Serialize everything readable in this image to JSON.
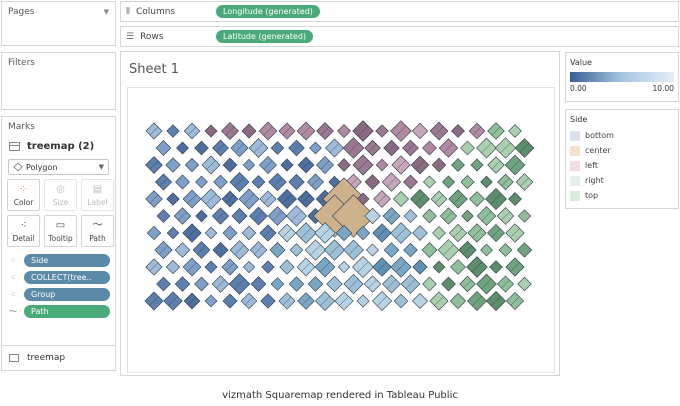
{
  "pages": {
    "title": "Pages"
  },
  "filters": {
    "title": "Filters"
  },
  "marks": {
    "title": "Marks",
    "layer": "treemap (2)",
    "mark_type": "Polygon",
    "buttons": [
      "Color",
      "Size",
      "Label",
      "Detail",
      "Tooltip",
      "Path"
    ],
    "pills": [
      {
        "label": "Side",
        "kind": "color"
      },
      {
        "label": "COLLECT(tree..",
        "kind": "detail"
      },
      {
        "label": "Group",
        "kind": "detail"
      },
      {
        "label": "Path",
        "kind": "path"
      }
    ]
  },
  "sheet_tab": {
    "label": "treemap"
  },
  "shelves": {
    "columns": {
      "label": "Columns",
      "pill": "Longitude (generated)"
    },
    "rows": {
      "label": "Rows",
      "pill": "Latitude (generated)"
    }
  },
  "sheet": {
    "title": "Sheet 1"
  },
  "value_legend": {
    "title": "Value",
    "min": "0.00",
    "max": "10.00"
  },
  "side_legend": {
    "title": "Side",
    "items": [
      {
        "label": "bottom",
        "color": "#dce3ee"
      },
      {
        "label": "center",
        "color": "#f3e3cc"
      },
      {
        "label": "left",
        "color": "#f2dde3"
      },
      {
        "label": "right",
        "color": "#e7eef0"
      },
      {
        "label": "top",
        "color": "#d9ecdc"
      }
    ]
  },
  "caption": "vizmath Squaremap rendered in Tableau Public"
}
